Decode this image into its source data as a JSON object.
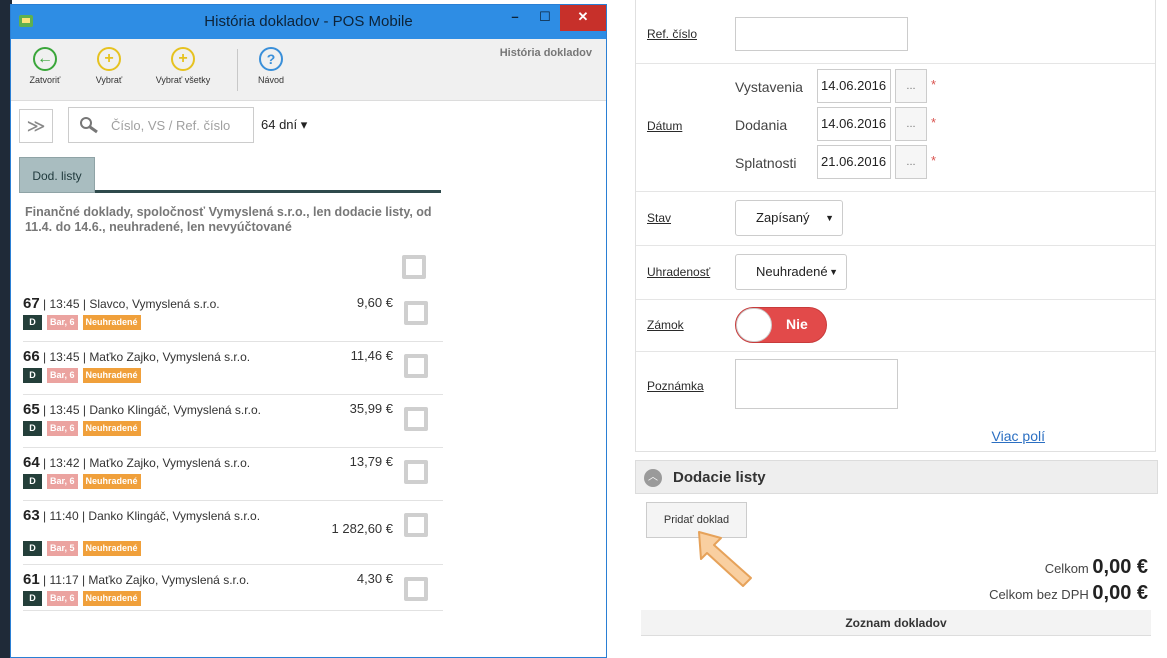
{
  "window": {
    "title": "História dokladov - POS Mobile",
    "section_title": "História dokladov",
    "controls": {
      "minimize": "–",
      "maximize": "☐",
      "close": "✕"
    }
  },
  "toolbar": {
    "close_label": "Zatvoriť",
    "select_label": "Vybrať",
    "select_all_label": "Vybrať všetky",
    "help_label": "Návod"
  },
  "filter": {
    "expand_glyph": "≫",
    "search_placeholder": "Číslo, VS / Ref. číslo",
    "days_label": "64 dní ▾"
  },
  "tabs": [
    {
      "label": "Dod. listy"
    }
  ],
  "description": "Finančné doklady, spoločnosť Vymyslená s.r.o., len dodacie listy, od 11.4. do 14.6., neuhradené, len nevyúčtované",
  "documents": [
    {
      "number": "67",
      "time": "13:45",
      "customer": "Slavco, Vymyslená s.r.o.",
      "amount": "9,60 €",
      "type": "D",
      "bar": "Bar, 6",
      "status": "Neuhradené"
    },
    {
      "number": "66",
      "time": "13:45",
      "customer": "Maťko Zajko, Vymyslená s.r.o.",
      "amount": "11,46 €",
      "type": "D",
      "bar": "Bar, 6",
      "status": "Neuhradené"
    },
    {
      "number": "65",
      "time": "13:45",
      "customer": "Danko Klingáč, Vymyslená s.r.o.",
      "amount": "35,99 €",
      "type": "D",
      "bar": "Bar, 6",
      "status": "Neuhradené"
    },
    {
      "number": "64",
      "time": "13:42",
      "customer": "Maťko Zajko, Vymyslená s.r.o.",
      "amount": "13,79 €",
      "type": "D",
      "bar": "Bar, 6",
      "status": "Neuhradené"
    },
    {
      "number": "63",
      "time": "11:40",
      "customer": "Danko Klingáč, Vymyslená s.r.o.",
      "amount": "1 282,60 €",
      "type": "D",
      "bar": "Bar, 5",
      "status": "Neuhradené"
    },
    {
      "number": "61",
      "time": "11:17",
      "customer": "Maťko Zajko, Vymyslená s.r.o.",
      "amount": "4,30 €",
      "type": "D",
      "bar": "Bar, 6",
      "status": "Neuhradené"
    }
  ],
  "form": {
    "ref_label": "Ref. číslo",
    "ref_value": "",
    "date_label": "Dátum",
    "dates": [
      {
        "label": "Vystavenia",
        "value": "14.06.2016"
      },
      {
        "label": "Dodania",
        "value": "14.06.2016"
      },
      {
        "label": "Splatnosti",
        "value": "21.06.2016"
      }
    ],
    "date_button": "...",
    "required_mark": "*",
    "state_label": "Stav",
    "state_value": "Zapísaný",
    "paid_label": "Uhradenosť",
    "paid_value": "Neuhradené",
    "lock_label": "Zámok",
    "lock_value": "Nie",
    "note_label": "Poznámka",
    "more_fields": "Viac polí"
  },
  "delivery_notes": {
    "title": "Dodacie listy",
    "collapse_glyph": "︿",
    "add_button": "Pridať doklad",
    "total_label": "Celkom",
    "total_value": "0,00 €",
    "total_no_vat_label": "Celkom bez DPH",
    "total_no_vat_value": "0,00 €",
    "list_header": "Zoznam dokladov"
  },
  "colors": {
    "titlebar": "#2e8de4",
    "close": "#c7302a",
    "tag_type": "#243f3a",
    "tag_bar": "#eba3a0",
    "tag_status": "#f0a03b",
    "toggle_off": "#e24a4a",
    "link": "#2b6fc2"
  }
}
